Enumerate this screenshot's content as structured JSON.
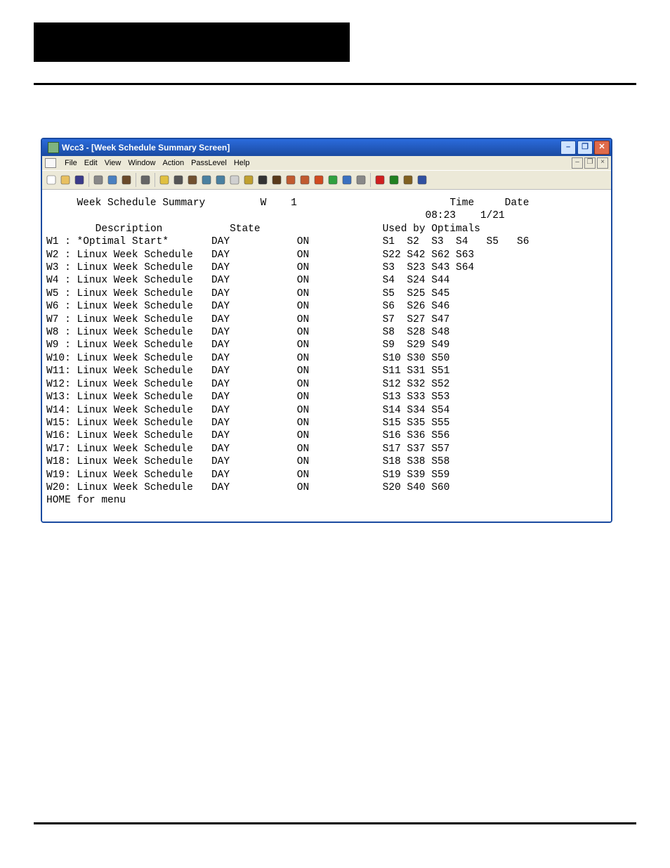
{
  "scheme": {
    "accent": "#1a4aa0"
  },
  "window": {
    "title": "Wcc3 - [Week Schedule Summary Screen]"
  },
  "window_controls": {
    "min": "–",
    "max": "❐",
    "close": "✕"
  },
  "child_controls": {
    "min": "–",
    "restore": "❐",
    "close": "×"
  },
  "menubar": {
    "items": [
      {
        "label": "File"
      },
      {
        "label": "Edit"
      },
      {
        "label": "View"
      },
      {
        "label": "Window"
      },
      {
        "label": "Action"
      },
      {
        "label": "PassLevel"
      },
      {
        "label": "Help"
      }
    ]
  },
  "header": {
    "title": "Week Schedule Summary",
    "col_w_label": "W",
    "col_w_value": "1",
    "time_label": "Time",
    "time_value": "08:23",
    "date_label": "Date",
    "date_value": "1/21",
    "col_desc": "Description",
    "col_state": "State",
    "col_used": "Used by Optimals",
    "footer": "HOME for menu"
  },
  "rows": [
    {
      "id": "W1 ",
      "sep": ":",
      "desc": " *Optimal Start*    ",
      "state1": "DAY",
      "state2": "ON",
      "opt": "S1  S2  S3  S4   S5   S6"
    },
    {
      "id": "W2 ",
      "sep": ":",
      "desc": " Linux Week Schedule",
      "state1": "DAY",
      "state2": "ON",
      "opt": "S22 S42 S62 S63"
    },
    {
      "id": "W3 ",
      "sep": ":",
      "desc": " Linux Week Schedule",
      "state1": "DAY",
      "state2": "ON",
      "opt": "S3  S23 S43 S64"
    },
    {
      "id": "W4 ",
      "sep": ":",
      "desc": " Linux Week Schedule",
      "state1": "DAY",
      "state2": "ON",
      "opt": "S4  S24 S44"
    },
    {
      "id": "W5 ",
      "sep": ":",
      "desc": " Linux Week Schedule",
      "state1": "DAY",
      "state2": "ON",
      "opt": "S5  S25 S45"
    },
    {
      "id": "W6 ",
      "sep": ":",
      "desc": " Linux Week Schedule",
      "state1": "DAY",
      "state2": "ON",
      "opt": "S6  S26 S46"
    },
    {
      "id": "W7 ",
      "sep": ":",
      "desc": " Linux Week Schedule",
      "state1": "DAY",
      "state2": "ON",
      "opt": "S7  S27 S47"
    },
    {
      "id": "W8 ",
      "sep": ":",
      "desc": " Linux Week Schedule",
      "state1": "DAY",
      "state2": "ON",
      "opt": "S8  S28 S48"
    },
    {
      "id": "W9 ",
      "sep": ":",
      "desc": " Linux Week Schedule",
      "state1": "DAY",
      "state2": "ON",
      "opt": "S9  S29 S49"
    },
    {
      "id": "W10",
      "sep": ":",
      "desc": " Linux Week Schedule",
      "state1": "DAY",
      "state2": "ON",
      "opt": "S10 S30 S50"
    },
    {
      "id": "W11",
      "sep": ":",
      "desc": " Linux Week Schedule",
      "state1": "DAY",
      "state2": "ON",
      "opt": "S11 S31 S51"
    },
    {
      "id": "W12",
      "sep": ":",
      "desc": " Linux Week Schedule",
      "state1": "DAY",
      "state2": "ON",
      "opt": "S12 S32 S52"
    },
    {
      "id": "W13",
      "sep": ":",
      "desc": " Linux Week Schedule",
      "state1": "DAY",
      "state2": "ON",
      "opt": "S13 S33 S53"
    },
    {
      "id": "W14",
      "sep": ":",
      "desc": " Linux Week Schedule",
      "state1": "DAY",
      "state2": "ON",
      "opt": "S14 S34 S54"
    },
    {
      "id": "W15",
      "sep": ":",
      "desc": " Linux Week Schedule",
      "state1": "DAY",
      "state2": "ON",
      "opt": "S15 S35 S55"
    },
    {
      "id": "W16",
      "sep": ":",
      "desc": " Linux Week Schedule",
      "state1": "DAY",
      "state2": "ON",
      "opt": "S16 S36 S56"
    },
    {
      "id": "W17",
      "sep": ":",
      "desc": " Linux Week Schedule",
      "state1": "DAY",
      "state2": "ON",
      "opt": "S17 S37 S57"
    },
    {
      "id": "W18",
      "sep": ":",
      "desc": " Linux Week Schedule",
      "state1": "DAY",
      "state2": "ON",
      "opt": "S18 S38 S58"
    },
    {
      "id": "W19",
      "sep": ":",
      "desc": " Linux Week Schedule",
      "state1": "DAY",
      "state2": "ON",
      "opt": "S19 S39 S59"
    },
    {
      "id": "W20",
      "sep": ":",
      "desc": " Linux Week Schedule",
      "state1": "DAY",
      "state2": "ON",
      "opt": "S20 S40 S60"
    }
  ],
  "toolbar_icons": [
    "new",
    "open",
    "save",
    "sep",
    "cut",
    "copy",
    "paste",
    "sep",
    "print",
    "sep",
    "help",
    "printer2",
    "camera",
    "stack1",
    "stack2",
    "doc",
    "bell",
    "binoculars",
    "alpha",
    "wand1",
    "wand2",
    "fire",
    "ok",
    "globe",
    "chart",
    "sep",
    "stop",
    "record",
    "run",
    "step"
  ]
}
